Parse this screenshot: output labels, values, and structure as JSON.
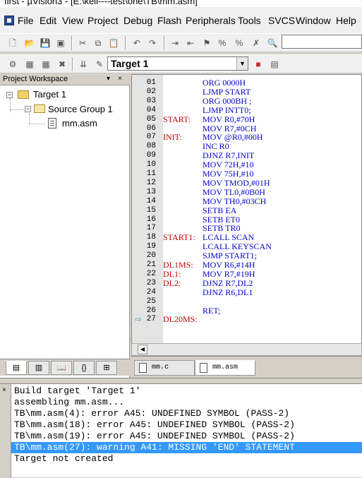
{
  "window": {
    "title": "first - µVision3 - [E:\\keil----test\\one\\TB\\mm.asm]"
  },
  "menu": [
    {
      "label": "File",
      "key": "F"
    },
    {
      "label": "Edit",
      "key": "E"
    },
    {
      "label": "View",
      "key": "V"
    },
    {
      "label": "Project",
      "key": "P"
    },
    {
      "label": "Debug",
      "key": "D"
    },
    {
      "label": "Flash",
      "key": "a"
    },
    {
      "label": "Peripherals",
      "key": "P"
    },
    {
      "label": "Tools",
      "key": "T"
    },
    {
      "label": "SVCS",
      "key": "S"
    },
    {
      "label": "Window",
      "key": "W"
    },
    {
      "label": "Help",
      "key": "H"
    }
  ],
  "toolbar2": {
    "target_value": "Target 1"
  },
  "workspace": {
    "title": "Project Workspace",
    "pin": "▾",
    "close": "×",
    "tree": [
      {
        "label": "Target 1"
      },
      {
        "label": "Source Group 1"
      },
      {
        "label": "mm.asm"
      }
    ]
  },
  "editor": {
    "lines": [
      {
        "n": "01",
        "label": "",
        "code": "ORG 0000H"
      },
      {
        "n": "02",
        "label": "",
        "code": "LJMP START"
      },
      {
        "n": "03",
        "label": "",
        "code": "ORG 000BH ;"
      },
      {
        "n": "04",
        "label": "",
        "code": "LJMP INTT0;"
      },
      {
        "n": "05",
        "label": "START:",
        "code": "MOV R0,#70H"
      },
      {
        "n": "06",
        "label": "",
        "code": "MOV R7,#0CH"
      },
      {
        "n": "07",
        "label": "INIT:",
        "code": "MOV @R0,#00H"
      },
      {
        "n": "08",
        "label": "",
        "code": "INC R0"
      },
      {
        "n": "09",
        "label": "",
        "code": "DJNZ R7,INIT"
      },
      {
        "n": "10",
        "label": "",
        "code": "MOV 72H,#10"
      },
      {
        "n": "11",
        "label": "",
        "code": "MOV 75H,#10"
      },
      {
        "n": "12",
        "label": "",
        "code": "MOV TMOD,#01H"
      },
      {
        "n": "13",
        "label": "",
        "code": "MOV TL0,#0B0H"
      },
      {
        "n": "14",
        "label": "",
        "code": "MOV TH0,#03CH"
      },
      {
        "n": "15",
        "label": "",
        "code": "SETB EA"
      },
      {
        "n": "16",
        "label": "",
        "code": "SETB ET0"
      },
      {
        "n": "17",
        "label": "",
        "code": "SETB TR0"
      },
      {
        "n": "18",
        "label": "START1:",
        "code": "LCALL SCAN"
      },
      {
        "n": "19",
        "label": "",
        "code": "LCALL KEYSCAN"
      },
      {
        "n": "20",
        "label": "",
        "code": "SJMP START1;"
      },
      {
        "n": "21",
        "label": "DL1MS:",
        "code": "MOV R6,#14H"
      },
      {
        "n": "22",
        "label": "DL1:",
        "code": "MOV R7,#19H"
      },
      {
        "n": "23",
        "label": "DL2:",
        "code": "DJNZ R7,DL2"
      },
      {
        "n": "24",
        "label": "",
        "code": "DJNZ R6,DL1"
      },
      {
        "n": "25",
        "label": "",
        "code": ""
      },
      {
        "n": "26",
        "label": "",
        "code": "RET;"
      },
      {
        "n": "27",
        "label": "DL20MS:",
        "code": ""
      }
    ],
    "current_line": "27"
  },
  "editor_tabs": [
    {
      "label": "mm.c"
    },
    {
      "label": "mm.asm"
    }
  ],
  "output": {
    "close": "×",
    "lines": [
      "Build target 'Target 1'",
      "assembling mm.asm...",
      "TB\\mm.asm(4): error A45: UNDEFINED SYMBOL (PASS-2)",
      "TB\\mm.asm(18): error A45: UNDEFINED SYMBOL (PASS-2)",
      "TB\\mm.asm(19): error A45: UNDEFINED SYMBOL (PASS-2)",
      "TB\\mm.asm(27): warning A41: MISSING 'END' STATEMENT",
      "Target not created"
    ],
    "selected_index": 5
  },
  "colors": {
    "selection": "#3399ff",
    "label": "#c00000",
    "code": "#0000cc"
  }
}
